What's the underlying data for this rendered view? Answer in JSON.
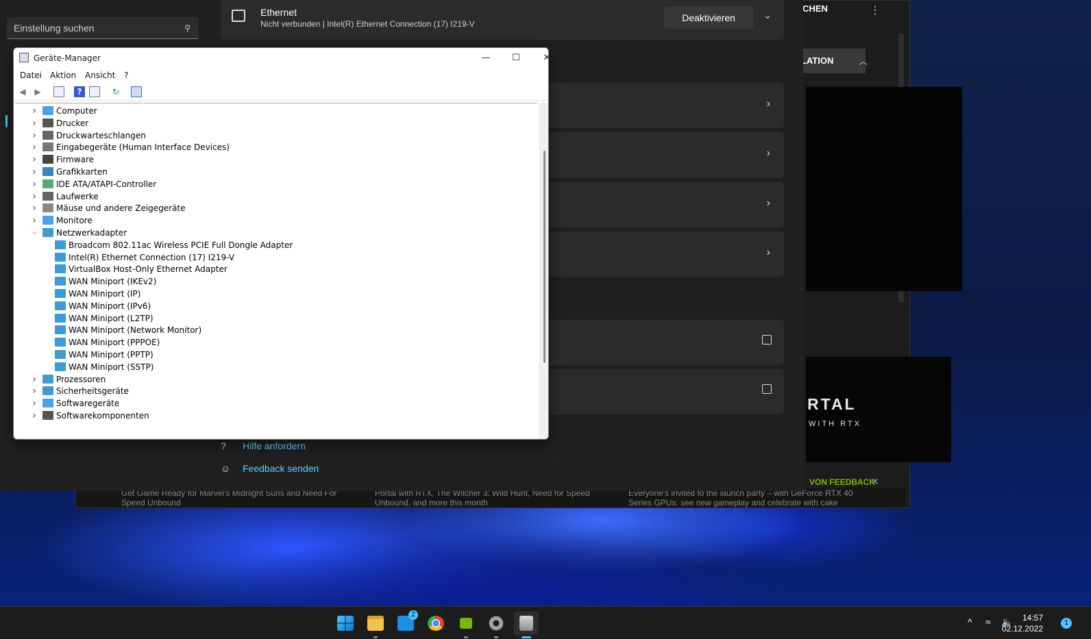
{
  "nvidia": {
    "search_label": "SUCHEN",
    "install_label": "LLATION",
    "portal_title": "RTAL",
    "portal_sub": "WITH RTX",
    "feedback_label": "VON FEEDBACK",
    "news": [
      "Get Game Ready for Marvel's Midnight Suns and Need For Speed Unbound",
      "Portal with RTX, The Witcher 3: Wild Hunt, Need for Speed Unbound, and more this month",
      "Everyone's invited to the launch party – with GeForce RTX 40 Series GPUs: see new gameplay and celebrate with cake"
    ],
    "news_partial": "...with GeForce RTX 40"
  },
  "settings": {
    "search_placeholder": "Einstellung suchen",
    "ethernet": {
      "title": "Ethernet",
      "subtitle": "Nicht verbunden | Intel(R) Ethernet Connection (17) I219-V",
      "button": "Deaktivieren"
    },
    "links": {
      "help": "Hilfe anfordern",
      "feedback": "Feedback senden"
    }
  },
  "device_manager": {
    "title": "Geräte-Manager",
    "menu": [
      "Datei",
      "Aktion",
      "Ansicht",
      "?"
    ],
    "tree": [
      {
        "label": "Computer",
        "expanded": false,
        "level": 0
      },
      {
        "label": "Drucker",
        "expanded": false,
        "level": 0
      },
      {
        "label": "Druckwarteschlangen",
        "expanded": false,
        "level": 0
      },
      {
        "label": "Eingabegeräte (Human Interface Devices)",
        "expanded": false,
        "level": 0
      },
      {
        "label": "Firmware",
        "expanded": false,
        "level": 0
      },
      {
        "label": "Grafikkarten",
        "expanded": false,
        "level": 0
      },
      {
        "label": "IDE ATA/ATAPI-Controller",
        "expanded": false,
        "level": 0
      },
      {
        "label": "Laufwerke",
        "expanded": false,
        "level": 0
      },
      {
        "label": "Mäuse und andere Zeigegeräte",
        "expanded": false,
        "level": 0
      },
      {
        "label": "Monitore",
        "expanded": false,
        "level": 0
      },
      {
        "label": "Netzwerkadapter",
        "expanded": true,
        "level": 0
      },
      {
        "label": "Broadcom 802.11ac Wireless PCIE Full Dongle Adapter",
        "level": 1
      },
      {
        "label": "Intel(R) Ethernet Connection (17) I219-V",
        "level": 1
      },
      {
        "label": "VirtualBox Host-Only Ethernet Adapter",
        "level": 1
      },
      {
        "label": "WAN Miniport (IKEv2)",
        "level": 1
      },
      {
        "label": "WAN Miniport (IP)",
        "level": 1
      },
      {
        "label": "WAN Miniport (IPv6)",
        "level": 1
      },
      {
        "label": "WAN Miniport (L2TP)",
        "level": 1
      },
      {
        "label": "WAN Miniport (Network Monitor)",
        "level": 1
      },
      {
        "label": "WAN Miniport (PPPOE)",
        "level": 1
      },
      {
        "label": "WAN Miniport (PPTP)",
        "level": 1
      },
      {
        "label": "WAN Miniport (SSTP)",
        "level": 1
      },
      {
        "label": "Prozessoren",
        "expanded": false,
        "level": 0
      },
      {
        "label": "Sicherheitsgeräte",
        "expanded": false,
        "level": 0
      },
      {
        "label": "Softwaregeräte",
        "expanded": false,
        "level": 0
      },
      {
        "label": "Softwarekomponenten",
        "expanded": false,
        "level": 0
      }
    ]
  },
  "taskbar": {
    "mail_badge": "2",
    "time": "14:57",
    "date": "02.12.2022",
    "notifications": "1"
  },
  "colors": {
    "accent": "#4cc2ff",
    "nvidia_green": "#76b900",
    "link": "#60cdff"
  }
}
